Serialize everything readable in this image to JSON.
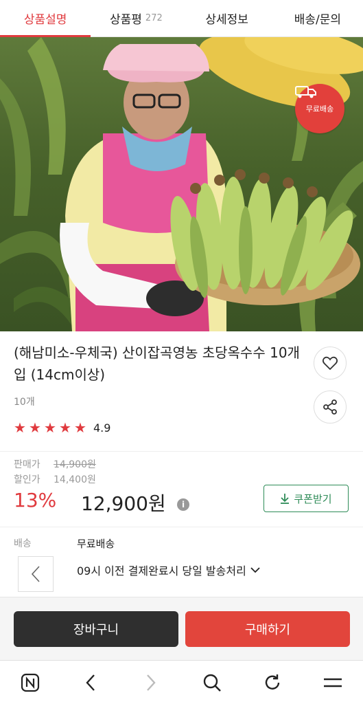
{
  "tabs": [
    {
      "label": "상품설명",
      "count": ""
    },
    {
      "label": "상품평",
      "count": "272"
    },
    {
      "label": "상세정보",
      "count": ""
    },
    {
      "label": "배송/문의",
      "count": ""
    }
  ],
  "hero": {
    "badge_label": "무료배송"
  },
  "product": {
    "title": "(해남미소-우체국) 산이잡곡영농 초당옥수수 10개입 (14cm이상)",
    "option": "10개",
    "rating": "4.9",
    "stars": 5
  },
  "price": {
    "sale_label": "판매가",
    "sale_value": "14,900원",
    "discount_label": "할인가",
    "discount_value": "14,400원",
    "discount_rate": "13%",
    "final_price": "12,900원",
    "coupon_label": "쿠폰받기"
  },
  "shipping": {
    "label": "배송",
    "value": "무료배송",
    "note": "09시 이전 결제완료시 당일 발송처리"
  },
  "actions": {
    "cart_label": "장바구니",
    "buy_label": "구매하기"
  },
  "colors": {
    "accent": "#e03a3e",
    "coupon": "#2e8b57",
    "cart": "#2f2f2f",
    "buy": "#e2453c"
  }
}
